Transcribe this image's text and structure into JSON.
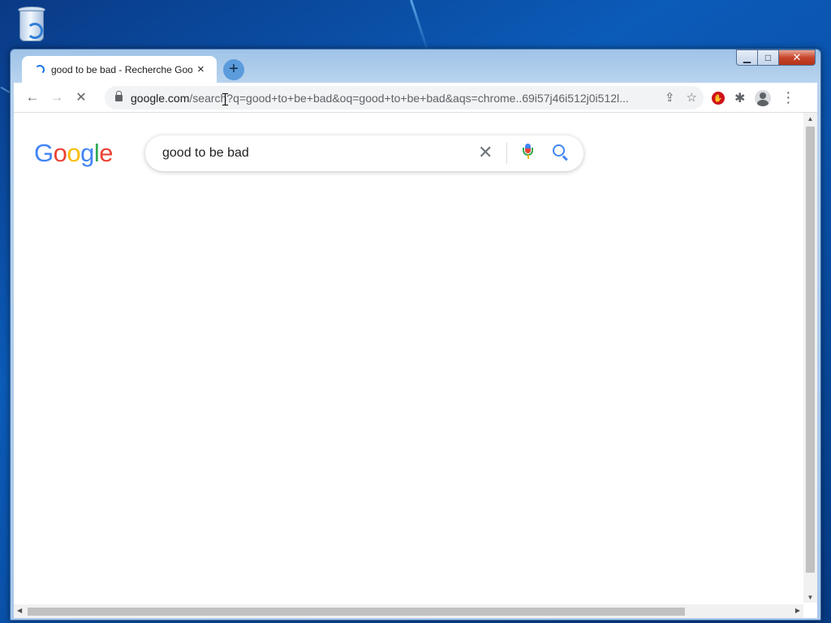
{
  "desktop": {
    "icons": [
      {
        "name": "recycle-bin-icon"
      }
    ]
  },
  "browser": {
    "tab": {
      "title": "good to be bad - Recherche Google",
      "close_glyph": "×",
      "state": "loading"
    },
    "new_tab_glyph": "+",
    "nav": {
      "back_glyph": "←",
      "forward_glyph": "→",
      "stop_glyph": "✕"
    },
    "address_bar": {
      "host": "google.com",
      "path": "/search?q=good+to+be+bad&oq=good+to+be+bad&aqs=chrome..69i57j46i512j0i512l..."
    },
    "omnibox_icons": {
      "share_glyph": "⇪",
      "bookmark_glyph": "☆"
    },
    "toolbar_icons": [
      "adblock-extension-icon",
      "extensions-icon",
      "profile-icon",
      "menu-icon"
    ],
    "menu_glyph": "⋮",
    "window_controls": {
      "minimize_glyph": "▁",
      "maximize_glyph": "□",
      "close_glyph": "✕"
    }
  },
  "page": {
    "logo_letters": [
      "G",
      "o",
      "o",
      "g",
      "l",
      "e"
    ],
    "search": {
      "query": "good to be bad",
      "clear_glyph": "✕"
    },
    "scrollbars": {
      "up_glyph": "▲",
      "down_glyph": "▼",
      "left_glyph": "◀",
      "right_glyph": "▶"
    }
  },
  "colors": {
    "google_blue": "#4285f4",
    "google_red": "#ea4335",
    "google_yellow": "#fbbc05",
    "google_green": "#34a853",
    "desktop_blue": "#0b5bb8"
  }
}
